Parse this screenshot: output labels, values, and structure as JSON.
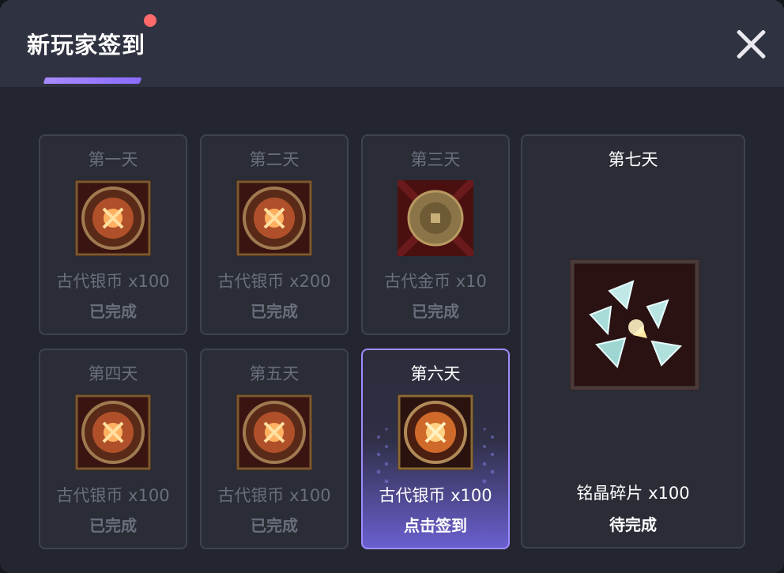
{
  "dialog": {
    "title": "新玩家签到",
    "close_icon": "close-icon",
    "accent_color": "#9d8cff"
  },
  "days": [
    {
      "day": "第一天",
      "reward": "古代银币 x100",
      "status": "已完成",
      "icon": "ancient-silver-coin-icon"
    },
    {
      "day": "第二天",
      "reward": "古代银币 x200",
      "status": "已完成",
      "icon": "ancient-silver-coin-icon"
    },
    {
      "day": "第三天",
      "reward": "古代金币 x10",
      "status": "已完成",
      "icon": "ancient-gold-coin-icon"
    },
    {
      "day": "第四天",
      "reward": "古代银币 x100",
      "status": "已完成",
      "icon": "ancient-silver-coin-icon"
    },
    {
      "day": "第五天",
      "reward": "古代银币 x100",
      "status": "已完成",
      "icon": "ancient-silver-coin-icon"
    },
    {
      "day": "第六天",
      "reward": "古代银币 x100",
      "status": "点击签到",
      "icon": "ancient-silver-coin-icon"
    },
    {
      "day": "第七天",
      "reward": "铭晶碎片 x100",
      "status": "待完成",
      "icon": "crystal-shard-icon"
    }
  ]
}
